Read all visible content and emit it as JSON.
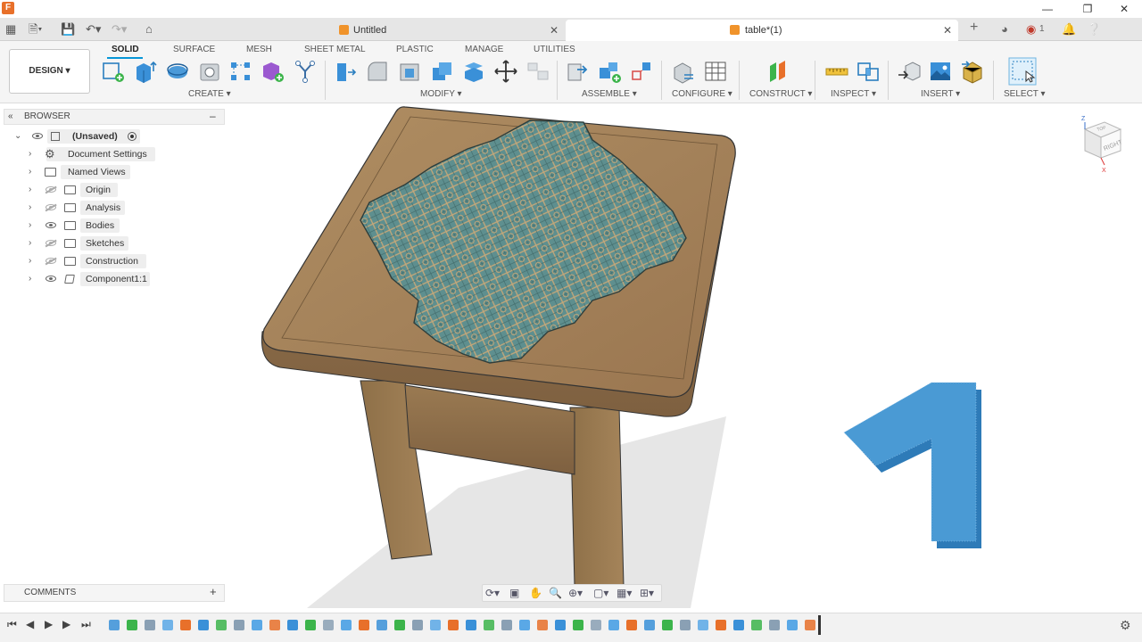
{
  "app": {
    "logo_letter": "F"
  },
  "tabs": [
    {
      "label": "Untitled",
      "active": false
    },
    {
      "label": "table*(1)",
      "active": true
    }
  ],
  "top_right": {
    "notification_count": "1"
  },
  "toolbar": {
    "design_label": "DESIGN",
    "workspace_tabs": [
      "SOLID",
      "SURFACE",
      "MESH",
      "SHEET METAL",
      "PLASTIC",
      "MANAGE",
      "UTILITIES"
    ],
    "active_workspace": "SOLID",
    "groups": [
      "CREATE",
      "MODIFY",
      "ASSEMBLE",
      "CONFIGURE",
      "CONSTRUCT",
      "INSPECT",
      "INSERT",
      "SELECT"
    ]
  },
  "browser": {
    "title": "BROWSER",
    "root_label": "(Unsaved)",
    "items": [
      {
        "label": "Document Settings",
        "icon": "gear-icon",
        "eye": "none"
      },
      {
        "label": "Named Views",
        "icon": "folder-icon",
        "eye": "none"
      },
      {
        "label": "Origin",
        "icon": "folder-icon",
        "eye": "hidden"
      },
      {
        "label": "Analysis",
        "icon": "folder-icon",
        "eye": "hidden"
      },
      {
        "label": "Bodies",
        "icon": "folder-icon",
        "eye": "visible"
      },
      {
        "label": "Sketches",
        "icon": "folder-icon",
        "eye": "hidden"
      },
      {
        "label": "Construction",
        "icon": "folder-icon",
        "eye": "hidden"
      },
      {
        "label": "Component1:1",
        "icon": "component-icon",
        "eye": "visible"
      }
    ]
  },
  "comments": {
    "title": "COMMENTS"
  },
  "viewcube": {
    "face_top": "TOP",
    "face_front": "RIGHT",
    "axis_z": "Z",
    "axis_x": "X"
  },
  "overlay": {
    "step_number": "1"
  },
  "colors": {
    "accent": "#0696d7",
    "wood": "#a8865a",
    "tile": "#5b8f92",
    "step_number": "#4a9ad4"
  }
}
